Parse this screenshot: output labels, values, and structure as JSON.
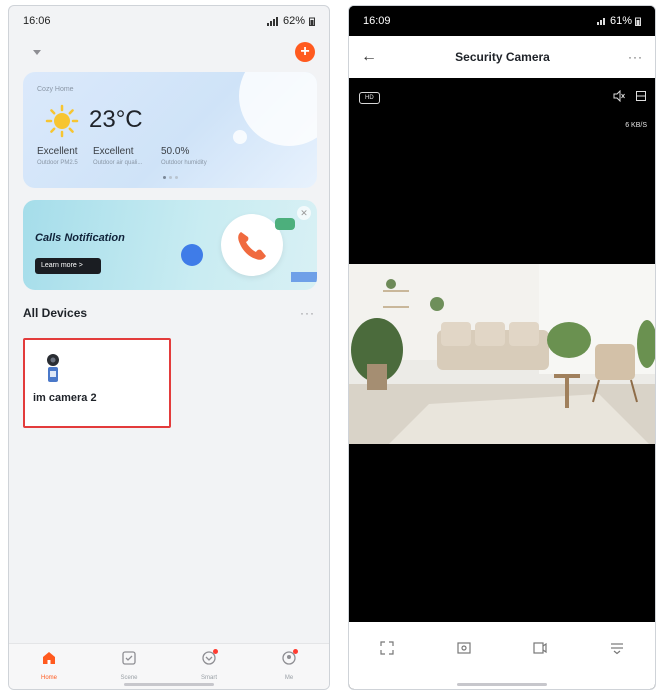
{
  "left": {
    "status": {
      "time": "16:06",
      "battery": "62%"
    },
    "weather": {
      "home_name": "Cozy Home",
      "temperature": "23°C",
      "metrics": [
        {
          "value": "Excellent",
          "label": "Outdoor PM2.5"
        },
        {
          "value": "Excellent",
          "label": "Outdoor air quali..."
        },
        {
          "value": "50.0%",
          "label": "Outdoor humidity"
        }
      ]
    },
    "promo": {
      "title": "Calls Notification",
      "button": "Learn more >"
    },
    "devices": {
      "section_title": "All Devices",
      "more": "···",
      "items": [
        {
          "name": "im camera 2"
        }
      ]
    },
    "tabs": [
      {
        "label": "Home",
        "active": true,
        "icon": "home-icon"
      },
      {
        "label": "Scene",
        "active": false,
        "icon": "scene-icon"
      },
      {
        "label": "Smart",
        "active": false,
        "icon": "smart-icon"
      },
      {
        "label": "Me",
        "active": false,
        "icon": "me-icon"
      }
    ]
  },
  "right": {
    "status": {
      "time": "16:09",
      "battery": "61%"
    },
    "header": {
      "title": "Security Camera",
      "back": "←",
      "menu": "···"
    },
    "video": {
      "hd": "HD",
      "speed": "6 KB/S"
    }
  },
  "colors": {
    "accent": "#ff5a1f",
    "highlight": "#e33b3b"
  }
}
